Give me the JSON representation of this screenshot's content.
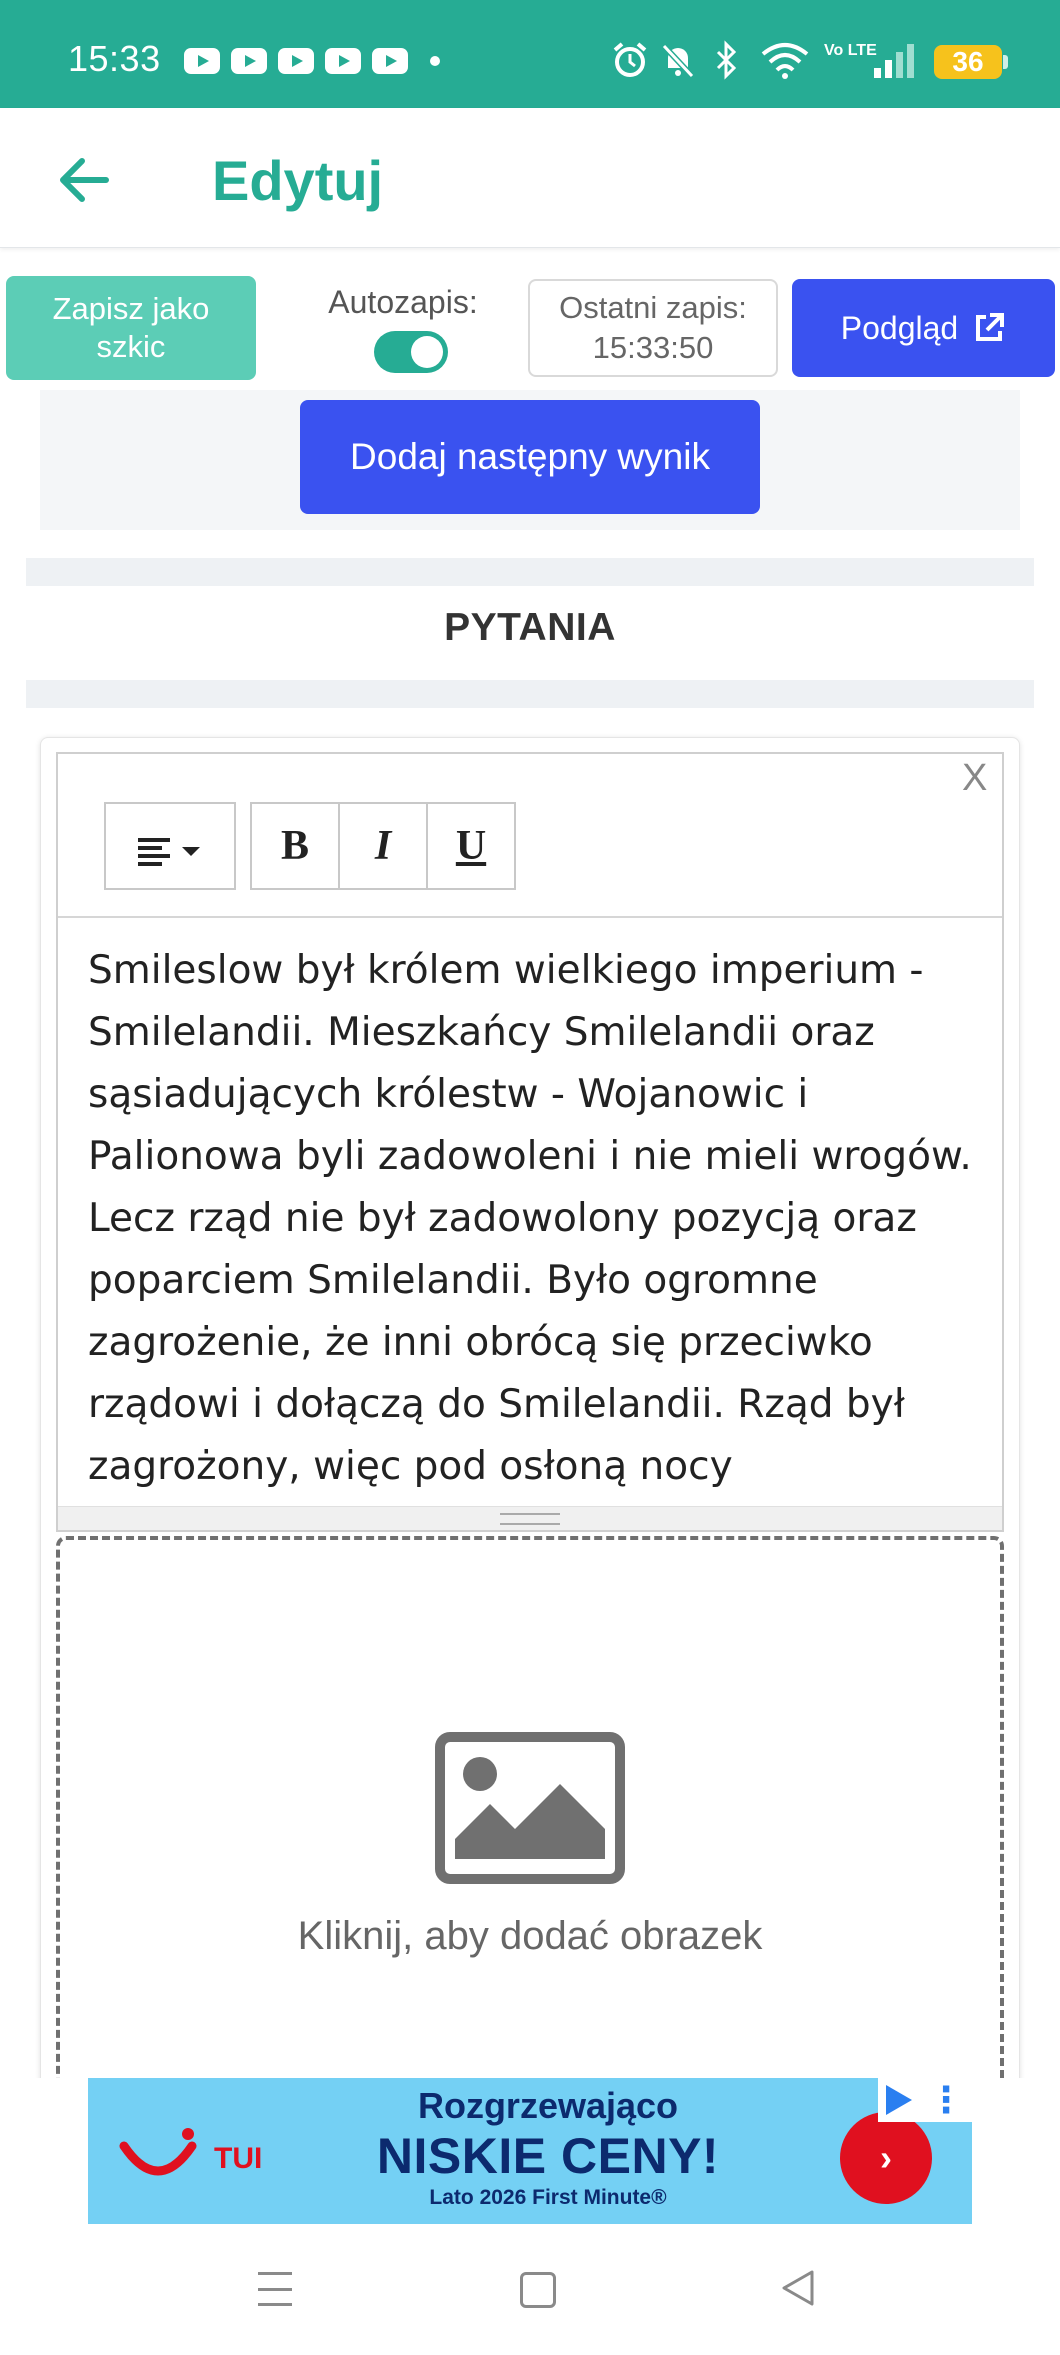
{
  "status_bar": {
    "time": "15:33",
    "battery": "36",
    "network": "Vo LTE"
  },
  "app_bar": {
    "title": "Edytuj"
  },
  "toolbar": {
    "draft_label": "Zapisz jako szkic",
    "autosave_label": "Autozapis:",
    "autosave_on": true,
    "last_save_label": "Ostatni zapis:",
    "last_save_time": "15:33:50",
    "preview_label": "Podgląd"
  },
  "results": {
    "add_result_label": "Dodaj następny wynik"
  },
  "questions": {
    "section_title": "PYTANIA",
    "close_label": "X",
    "editor": {
      "align_icon": "align-left-icon",
      "bold_label": "B",
      "italic_label": "I",
      "underline_label": "U",
      "content": "Smileslow był królem wielkiego imperium - Smilelandii. Mieszkańcy Smilelandii oraz sąsiadujących królestw - Wojanowic i Palionowa byli zadowoleni i nie mieli wrogów. Lecz rząd nie był zadowolony pozycją oraz poparciem Smilelandii. Było ogromne zagrożenie, że inni obrócą się przeciwko rządowi i dołączą do Smilelandii. Rząd był zagrożony, więc pod osłoną nocy"
    },
    "image_caption": "Kliknij, aby dodać obrazek"
  },
  "ad": {
    "brand": "TUI",
    "line1": "Rozgrzewająco",
    "line2": "NISKIE CENY!",
    "line3": "Lato 2026 First Minute®",
    "cta": "›",
    "bg_color": "#74d0f4"
  },
  "colors": {
    "accent": "#26ac94",
    "primary_button": "#3a52f0",
    "draft_button": "#5ccdb6"
  }
}
